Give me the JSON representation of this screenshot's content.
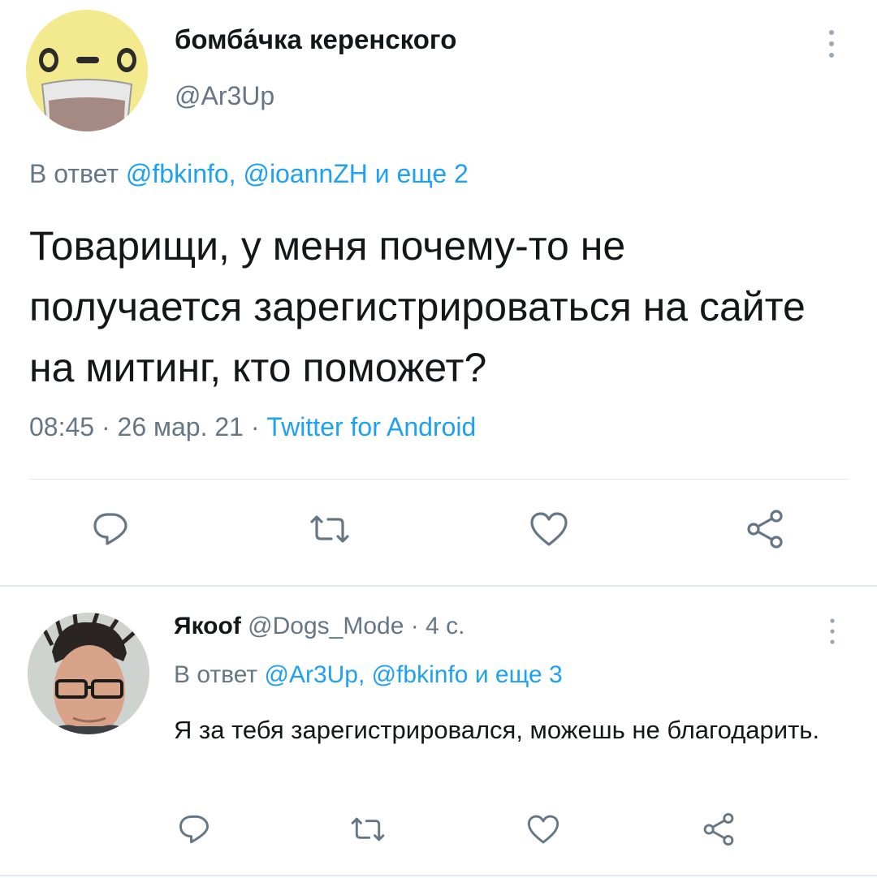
{
  "main_tweet": {
    "display_name": "бомба́чка керенского",
    "handle": "@Ar3Up",
    "reply_prefix": "В ответ",
    "reply_mentions": "@fbkinfo, @ioannZH",
    "reply_suffix": "и еще 2",
    "text": "Товарищи, у меня почему-то не получается зарегистрироваться на сайте на митинг, кто поможет?",
    "time": "08:45 · 26 мар. 21 ·",
    "source": "Twitter for Android",
    "actions": {
      "reply": "reply-icon",
      "retweet": "retweet-icon",
      "like": "heart-icon",
      "share": "share-icon"
    }
  },
  "reply_tweet": {
    "display_name": "Якооf",
    "meta": "@Dogs_Mode · 4 с.",
    "reply_prefix": "В ответ",
    "reply_mentions": "@Ar3Up, @fbkinfo",
    "reply_suffix": "и еще 3",
    "text": "Я за тебя зарегистрировался, можешь не благодарить."
  },
  "colors": {
    "link": "#1da1f2",
    "secondary_text": "#657786",
    "primary_text": "#14171a",
    "icon": "#657786",
    "divider": "#e1e8ed"
  }
}
